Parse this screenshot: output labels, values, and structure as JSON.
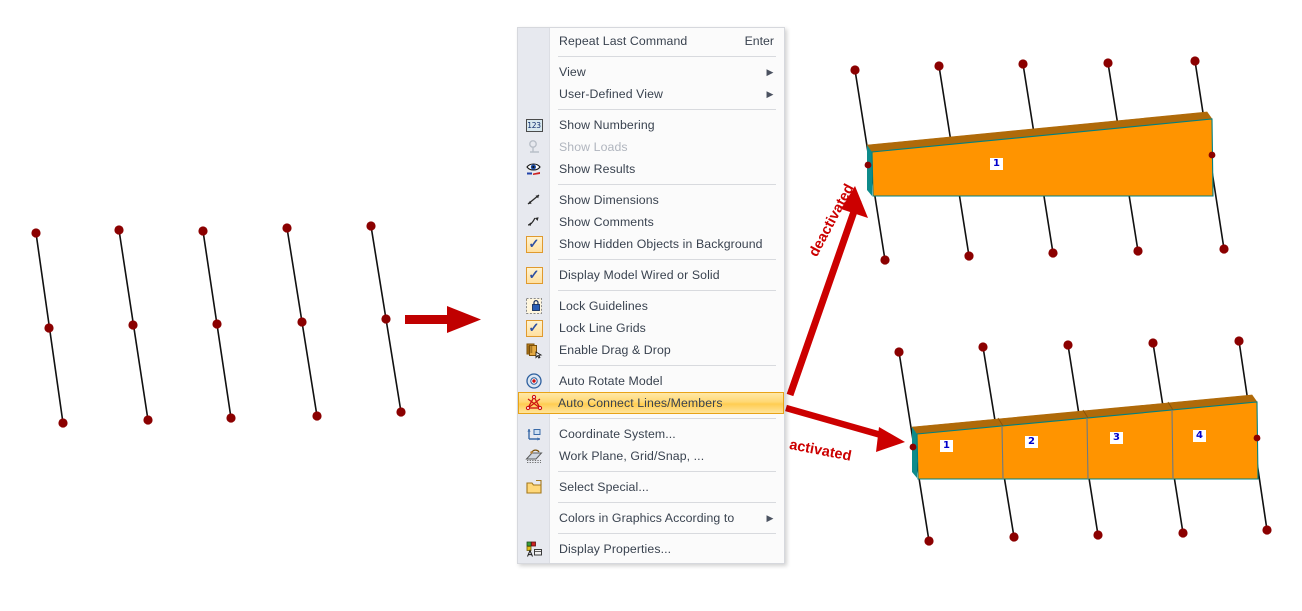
{
  "menu": {
    "name": "graphics-context-menu",
    "items": [
      {
        "label": "Repeat Last Command",
        "accel": "Enter",
        "icon": "none",
        "state": "normal",
        "submenu": false,
        "sep_after": true
      },
      {
        "label": "View",
        "accel": "",
        "icon": "none",
        "state": "normal",
        "submenu": true,
        "sep_after": false
      },
      {
        "label": "User-Defined View",
        "accel": "",
        "icon": "none",
        "state": "normal",
        "submenu": true,
        "sep_after": true
      },
      {
        "label": "Show Numbering",
        "accel": "",
        "icon": "numbering-123-icon",
        "state": "normal",
        "submenu": false,
        "sep_after": false
      },
      {
        "label": "Show Loads",
        "accel": "",
        "icon": "load-icon",
        "state": "disabled",
        "submenu": false,
        "sep_after": false
      },
      {
        "label": "Show Results",
        "accel": "",
        "icon": "results-eye-icon",
        "state": "normal",
        "submenu": false,
        "sep_after": true
      },
      {
        "label": "Show Dimensions",
        "accel": "",
        "icon": "dimension-arrow-icon",
        "state": "normal",
        "submenu": false,
        "sep_after": false
      },
      {
        "label": "Show Comments",
        "accel": "",
        "icon": "comment-arrow-icon",
        "state": "normal",
        "submenu": false,
        "sep_after": false
      },
      {
        "label": "Show Hidden Objects in Background",
        "accel": "",
        "icon": "checkbox-checked-icon",
        "state": "normal",
        "submenu": false,
        "sep_after": true
      },
      {
        "label": "Display Model Wired or Solid",
        "accel": "",
        "icon": "checkbox-checked-icon",
        "state": "normal",
        "submenu": false,
        "sep_after": true
      },
      {
        "label": "Lock Guidelines",
        "accel": "",
        "icon": "lock-guidelines-icon",
        "state": "normal",
        "submenu": false,
        "sep_after": false
      },
      {
        "label": "Lock Line Grids",
        "accel": "",
        "icon": "checkbox-checked-icon",
        "state": "normal",
        "submenu": false,
        "sep_after": false
      },
      {
        "label": "Enable Drag & Drop",
        "accel": "",
        "icon": "drag-drop-icon",
        "state": "normal",
        "submenu": false,
        "sep_after": true
      },
      {
        "label": "Auto Rotate Model",
        "accel": "",
        "icon": "auto-rotate-icon",
        "state": "normal",
        "submenu": false,
        "sep_after": false
      },
      {
        "label": "Auto Connect Lines/Members",
        "accel": "",
        "icon": "auto-connect-icon",
        "state": "highlight",
        "submenu": false,
        "sep_after": true
      },
      {
        "label": "Coordinate System...",
        "accel": "",
        "icon": "coordinate-system-icon",
        "state": "normal",
        "submenu": false,
        "sep_after": false
      },
      {
        "label": "Work Plane, Grid/Snap, ...",
        "accel": "",
        "icon": "work-plane-icon",
        "state": "normal",
        "submenu": false,
        "sep_after": true
      },
      {
        "label": "Select Special...",
        "accel": "",
        "icon": "select-special-icon",
        "state": "normal",
        "submenu": false,
        "sep_after": true
      },
      {
        "label": "Colors in Graphics According to",
        "accel": "",
        "icon": "none",
        "state": "normal",
        "submenu": true,
        "sep_after": true
      },
      {
        "label": "Display Properties...",
        "accel": "",
        "icon": "display-properties-icon",
        "state": "normal",
        "submenu": false,
        "sep_after": false
      }
    ]
  },
  "annotations": {
    "deactivated": "deactivated",
    "activated": "activated"
  },
  "diagrams": {
    "before": {
      "name": "unconnected-lines-diagram",
      "line_count": 5,
      "nodes_per_line": 3
    },
    "deactivated_result": {
      "name": "single-surface-diagram",
      "surface_labels": [
        "1"
      ]
    },
    "activated_result": {
      "name": "split-surfaces-diagram",
      "surface_labels": [
        "1",
        "2",
        "3",
        "4"
      ]
    }
  },
  "colors": {
    "accent_red": "#cc0000",
    "surface_orange": "#FF9400",
    "surface_edge_teal": "#00807f",
    "surface_side_brown": "#b06a09",
    "node_red": "#8b0000",
    "label_blue": "#0000cc",
    "menu_highlight": "#ffd873",
    "menu_text": "#39424f"
  }
}
